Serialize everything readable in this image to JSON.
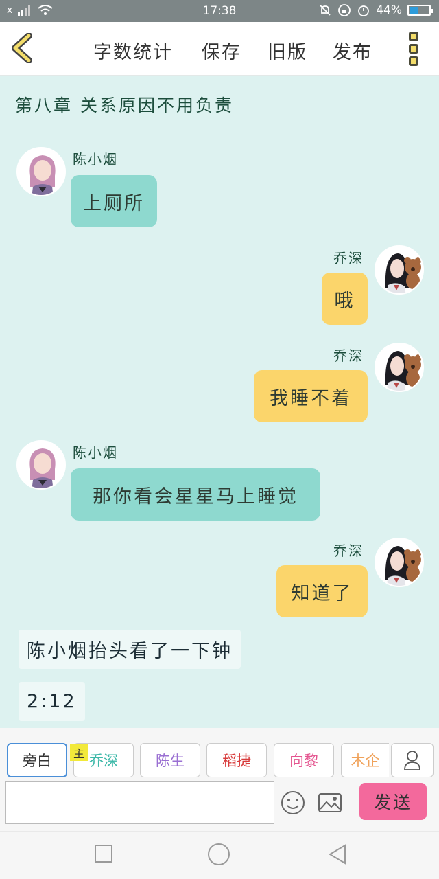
{
  "status_bar": {
    "signal": "x",
    "time": "17:38",
    "battery": "44%",
    "battery_level": 0.44
  },
  "toolbar": {
    "word_count_label": "字数统计",
    "save_label": "保存",
    "old_version_label": "旧版",
    "publish_label": "发布"
  },
  "chapter_title": "第八章  关系原因不用负责",
  "messages": [
    {
      "speaker": "陈小烟",
      "text": "上厕所"
    },
    {
      "speaker": "乔深",
      "text": "哦"
    },
    {
      "speaker": "乔深",
      "text": "我睡不着"
    },
    {
      "speaker": "陈小烟",
      "text": "那你看会星星马上睡觉"
    },
    {
      "speaker": "乔深",
      "text": "知道了"
    }
  ],
  "narrations": [
    "陈小烟抬头看了一下钟",
    "2:12"
  ],
  "characters": [
    {
      "label": "旁白",
      "color": "#333333",
      "selected": true
    },
    {
      "label": "乔深",
      "color": "#3cb8a8",
      "badge": "主"
    },
    {
      "label": "陈生",
      "color": "#9a6fd2"
    },
    {
      "label": "稻捷",
      "color": "#d83b3b"
    },
    {
      "label": "向黎",
      "color": "#e4548f"
    },
    {
      "label": "木企",
      "color": "#f0a25a"
    }
  ],
  "input": {
    "value": "",
    "placeholder": ""
  },
  "send_label": "发送",
  "colors": {
    "chat_bg": "#ddf2f0",
    "left_bubble": "#8ed9cf",
    "right_bubble": "#fbd56b",
    "send": "#f3699c",
    "accent": "#f3dd6a"
  }
}
